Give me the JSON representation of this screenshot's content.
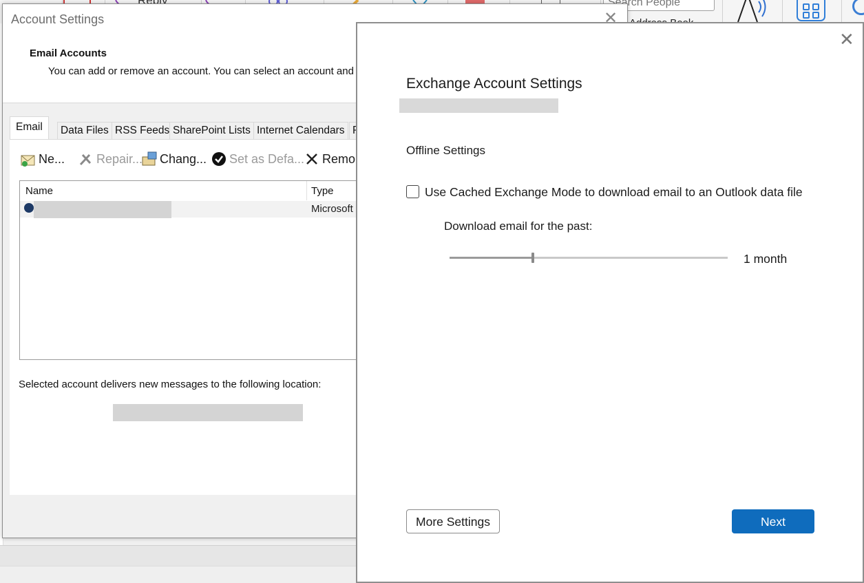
{
  "ribbon": {
    "reply_label": "Reply",
    "search_placeholder": "Search People",
    "address_book_label": "Address Book"
  },
  "account_settings": {
    "title": "Account Settings",
    "header_title": "Email Accounts",
    "header_desc": "You can add or remove an account. You can select an account and",
    "tabs": [
      "Email",
      "Data Files",
      "RSS Feeds",
      "SharePoint Lists",
      "Internet Calendars",
      "P"
    ],
    "toolbar": {
      "new": "Ne...",
      "repair": "Repair...",
      "change": "Chang...",
      "set_default": "Set as Defa...",
      "remove": "Remo..."
    },
    "list": {
      "col_name": "Name",
      "col_type": "Type",
      "rows": [
        {
          "type": "Microsoft"
        }
      ]
    },
    "deliver_text": "Selected account delivers new messages to the following location:"
  },
  "exchange": {
    "title": "Exchange Account Settings",
    "offline_heading": "Offline Settings",
    "cached_mode_label": "Use Cached Exchange Mode to download email to an Outlook data file",
    "cached_mode_checked": false,
    "download_label": "Download email for the past:",
    "slider_value_label": "1 month",
    "slider_fraction": 0.3,
    "more_settings_button": "More Settings",
    "next_button": "Next"
  },
  "colors": {
    "accent": "#0f6cbd",
    "redaction": "#d4d4d4"
  }
}
